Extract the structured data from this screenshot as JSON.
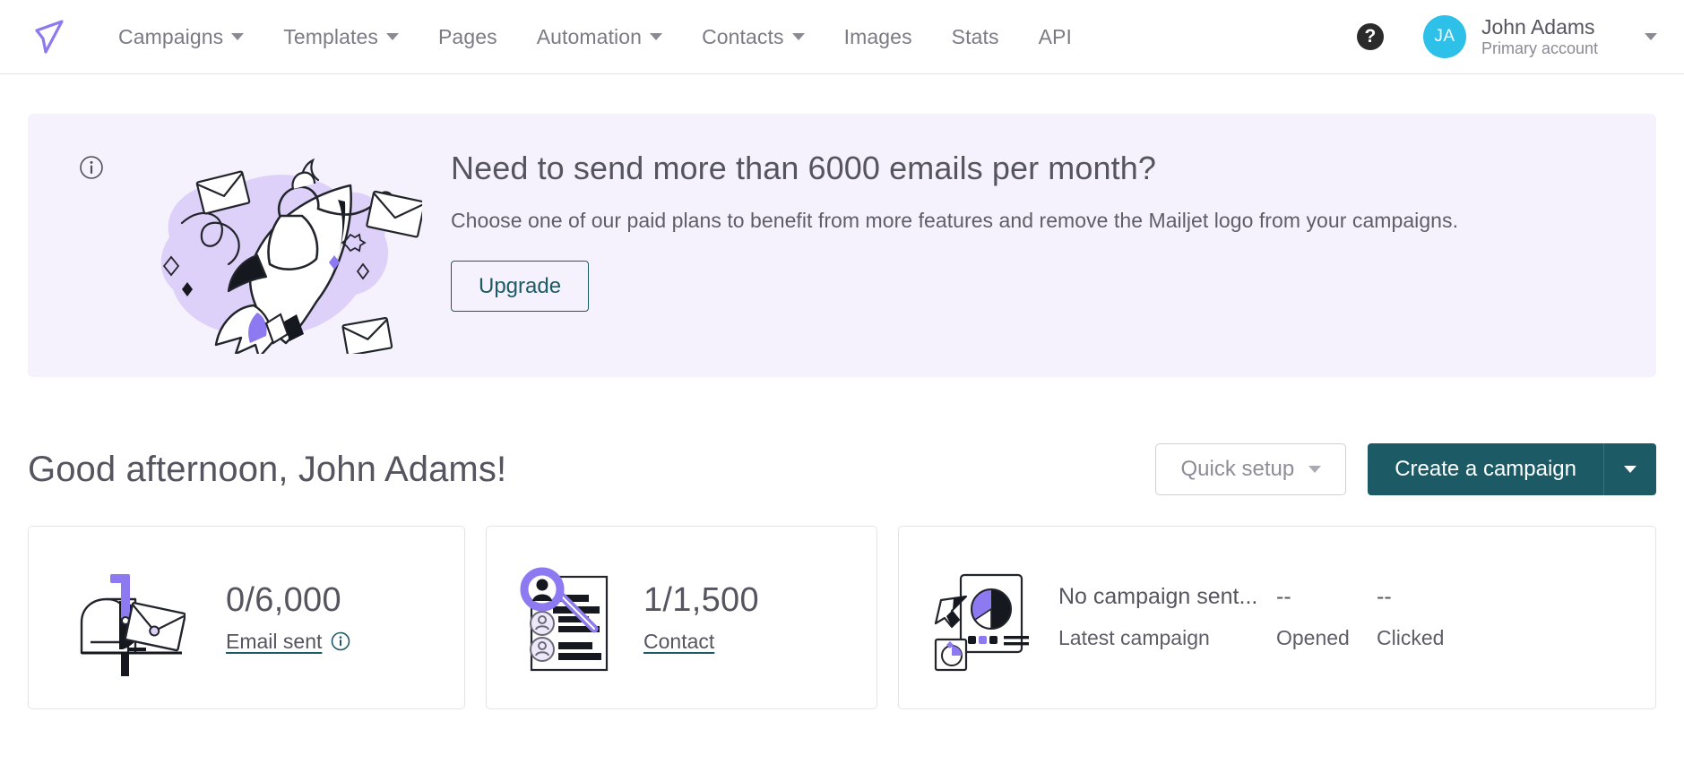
{
  "navbar": {
    "logo_name": "mailjet-logo",
    "items": [
      {
        "label": "Campaigns",
        "has_caret": true
      },
      {
        "label": "Templates",
        "has_caret": true
      },
      {
        "label": "Pages",
        "has_caret": false
      },
      {
        "label": "Automation",
        "has_caret": true
      },
      {
        "label": "Contacts",
        "has_caret": true
      },
      {
        "label": "Images",
        "has_caret": false
      },
      {
        "label": "Stats",
        "has_caret": false
      },
      {
        "label": "API",
        "has_caret": false
      }
    ],
    "help_label": "?",
    "avatar_initials": "JA",
    "account_name": "John Adams",
    "account_sub": "Primary account"
  },
  "banner": {
    "title": "Need to send more than 6000 emails per month?",
    "subtitle": "Choose one of our paid plans to benefit from more features and remove the Mailjet logo from your campaigns.",
    "upgrade_label": "Upgrade",
    "background": "#f5f2fd"
  },
  "greeting": {
    "text": "Good afternoon, John Adams!",
    "quick_setup_label": "Quick setup",
    "create_campaign_label": "Create a campaign",
    "primary_color": "#1c5a66"
  },
  "cards": {
    "email": {
      "value": "0/6,000",
      "link_label": "Email sent"
    },
    "contact": {
      "value": "1/1,500",
      "link_label": "Contact"
    },
    "campaign": {
      "latest_value": "No campaign sent...",
      "latest_label": "Latest campaign",
      "opened_value": "--",
      "opened_label": "Opened",
      "clicked_value": "--",
      "clicked_label": "Clicked"
    }
  }
}
